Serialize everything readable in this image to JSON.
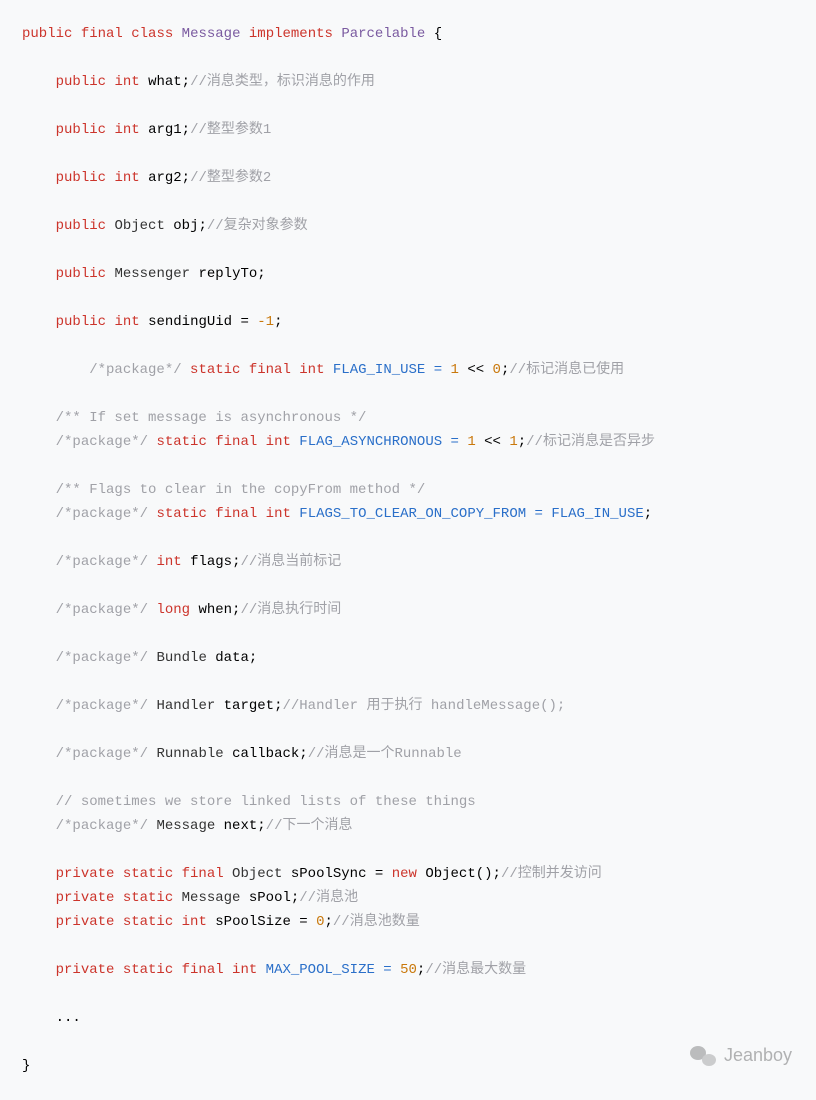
{
  "code": {
    "decl": {
      "public": "public",
      "final": "final",
      "class": "class",
      "Message": "Message",
      "implements": "implements",
      "Parcelable": "Parcelable",
      "brace_open": "{",
      "brace_close": "}"
    },
    "l_what": {
      "mods": "public",
      "type": "int",
      "name": "what;",
      "comment": "//消息类型，标识消息的作用"
    },
    "l_arg1": {
      "mods": "public",
      "type": "int",
      "name": "arg1;",
      "comment": "//整型参数1"
    },
    "l_arg2": {
      "mods": "public",
      "type": "int",
      "name": "arg2;",
      "comment": "//整型参数2"
    },
    "l_obj": {
      "mods": "public",
      "type": "Object",
      "name": "obj;",
      "comment": "//复杂对象参数"
    },
    "l_replyTo": {
      "mods": "public",
      "type": "Messenger",
      "name": "replyTo;"
    },
    "l_sendingUid": {
      "mods": "public",
      "type": "int",
      "name": "sendingUid = ",
      "num": "-1",
      "semi": ";"
    },
    "l_flagInUse": {
      "pkg": "/*package*/",
      "mods": "static final",
      "type": "int",
      "name": "FLAG_IN_USE = ",
      "num1": "1",
      "op": " << ",
      "num2": "0",
      "semi": ";",
      "comment": "//标记消息已使用"
    },
    "l_asyncDoc": {
      "doc": "/** If set message is asynchronous */"
    },
    "l_flagAsync": {
      "pkg": "/*package*/",
      "mods": "static final",
      "type": "int",
      "name": "FLAG_ASYNCHRONOUS = ",
      "num1": "1",
      "op": " << ",
      "num2": "1",
      "semi": ";",
      "comment": "//标记消息是否异步"
    },
    "l_clearDoc": {
      "doc": "/** Flags to clear in the copyFrom method */"
    },
    "l_flagClear": {
      "pkg": "/*package*/",
      "mods": "static final",
      "type": "int",
      "name": "FLAGS_TO_CLEAR_ON_COPY_FROM = ",
      "val": "FLAG_IN_USE",
      "semi": ";"
    },
    "l_flags": {
      "pkg": "/*package*/",
      "type": "int",
      "name": "flags;",
      "comment": "//消息当前标记"
    },
    "l_when": {
      "pkg": "/*package*/",
      "type": "long",
      "name": "when;",
      "comment": "//消息执行时间"
    },
    "l_data": {
      "pkg": "/*package*/",
      "type": "Bundle",
      "name": "data;"
    },
    "l_target": {
      "pkg": "/*package*/",
      "type": "Handler",
      "name": "target;",
      "comment": "//Handler 用于执行 handleMessage();"
    },
    "l_callback": {
      "pkg": "/*package*/",
      "type": "Runnable",
      "name": "callback;",
      "comment": "//消息是一个Runnable"
    },
    "l_nextDoc": {
      "doc": "// sometimes we store linked lists of these things"
    },
    "l_next": {
      "pkg": "/*package*/",
      "type": "Message",
      "name": "next;",
      "comment": "//下一个消息"
    },
    "l_poolSync": {
      "mods": "private static final",
      "type": "Object",
      "name": "sPoolSync = ",
      "new": "new",
      "ctor": "Object();",
      "comment": "//控制并发访问"
    },
    "l_sPool": {
      "mods": "private static",
      "type": "Message",
      "name": "sPool;",
      "comment": "//消息池"
    },
    "l_sPoolSize": {
      "mods": "private static",
      "type": "int",
      "name": "sPoolSize = ",
      "num": "0",
      "semi": ";",
      "comment": "//消息池数量"
    },
    "l_maxPool": {
      "mods": "private static final",
      "type": "int",
      "name": "MAX_POOL_SIZE = ",
      "num": "50",
      "semi": ";",
      "comment": "//消息最大数量"
    },
    "ellipsis": "..."
  },
  "watermark": {
    "text": "Jeanboy"
  }
}
